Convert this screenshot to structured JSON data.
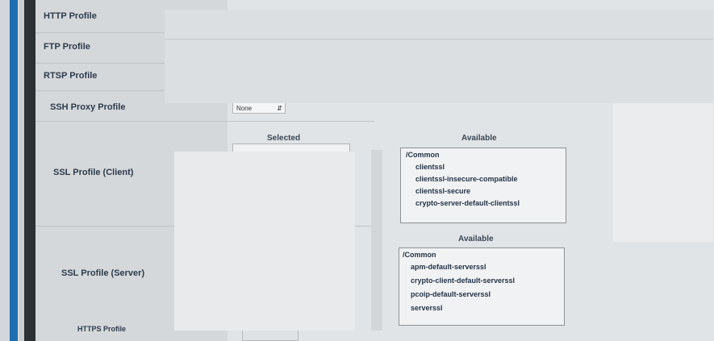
{
  "profiles": {
    "http": "HTTP Profile",
    "ftp": "FTP Profile",
    "rtsp": "RTSP Profile",
    "ssh": "SSH Proxy Profile",
    "ssl_client": "SSL Profile (Client)",
    "ssl_server": "SSL Profile (Server)",
    "partial_bottom": "HTTPS Profile"
  },
  "ssh_proxy": {
    "value": "None"
  },
  "client_ssl": {
    "selected_heading": "Selected",
    "available_heading": "Available",
    "group": "/Common",
    "options": [
      "clientssl",
      "clientssl-insecure-compatible",
      "clientssl-secure",
      "crypto-server-default-clientssl"
    ]
  },
  "server_ssl": {
    "available_heading": "Available",
    "group": "/Common",
    "options": [
      "apm-default-serverssl",
      "crypto-client-default-serverssl",
      "pcoip-default-serverssl",
      "serverssl"
    ]
  }
}
